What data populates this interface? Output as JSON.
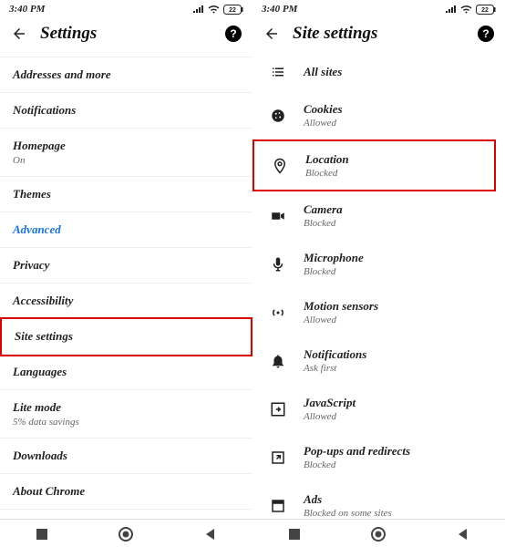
{
  "status": {
    "time": "3:40 PM",
    "battery": "22"
  },
  "left": {
    "title": "Settings",
    "items": [
      {
        "label": "Addresses and more"
      },
      {
        "label": "Notifications"
      },
      {
        "label": "Homepage",
        "sub": "On"
      },
      {
        "label": "Themes"
      },
      {
        "label": "Advanced",
        "advanced": true
      },
      {
        "label": "Privacy"
      },
      {
        "label": "Accessibility"
      },
      {
        "label": "Site settings",
        "highlight": true
      },
      {
        "label": "Languages"
      },
      {
        "label": "Lite mode",
        "sub": "5% data savings"
      },
      {
        "label": "Downloads"
      },
      {
        "label": "About Chrome"
      }
    ]
  },
  "right": {
    "title": "Site settings",
    "items": [
      {
        "icon": "list",
        "label": "All sites"
      },
      {
        "icon": "cookie",
        "label": "Cookies",
        "sub": "Allowed"
      },
      {
        "icon": "location",
        "label": "Location",
        "sub": "Blocked",
        "highlight": true
      },
      {
        "icon": "camera",
        "label": "Camera",
        "sub": "Blocked"
      },
      {
        "icon": "mic",
        "label": "Microphone",
        "sub": "Blocked"
      },
      {
        "icon": "motion",
        "label": "Motion sensors",
        "sub": "Allowed"
      },
      {
        "icon": "bell",
        "label": "Notifications",
        "sub": "Ask first"
      },
      {
        "icon": "js",
        "label": "JavaScript",
        "sub": "Allowed"
      },
      {
        "icon": "popup",
        "label": "Pop-ups and redirects",
        "sub": "Blocked"
      },
      {
        "icon": "ads",
        "label": "Ads",
        "sub": "Blocked on some sites"
      }
    ]
  }
}
